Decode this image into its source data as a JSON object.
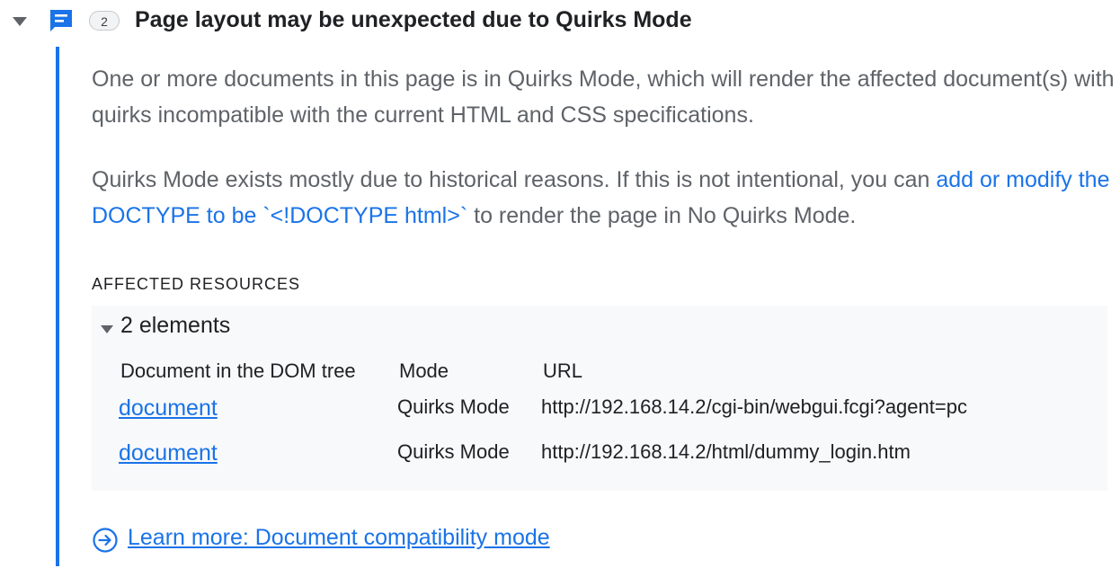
{
  "issue": {
    "count": "2",
    "title": "Page layout may be unexpected due to Quirks Mode",
    "paragraph1": "One or more documents in this page is in Quirks Mode, which will render the affected document(s) with quirks incompatible with the current HTML and CSS specifications.",
    "paragraph2_before": "Quirks Mode exists mostly due to historical reasons. If this is not intentional, you can ",
    "paragraph2_link": "add or modify the DOCTYPE to be `<!DOCTYPE html>`",
    "paragraph2_after": " to render the page in No Quirks Mode.",
    "icon": "issue-page-icon"
  },
  "affected": {
    "heading": "AFFECTED RESOURCES",
    "summary": "2 elements",
    "columns": [
      "Document in the DOM tree",
      "Mode",
      "URL"
    ],
    "rows": [
      {
        "document": "document",
        "mode": "Quirks Mode",
        "url": "http://192.168.14.2/cgi-bin/webgui.fcgi?agent=pc"
      },
      {
        "document": "document",
        "mode": "Quirks Mode",
        "url": "http://192.168.14.2/html/dummy_login.htm"
      }
    ]
  },
  "learn_more": {
    "label": "Learn more: Document compatibility mode",
    "icon": "arrow-circle-right-icon"
  },
  "colors": {
    "accent": "#1a73e8",
    "text": "#202124",
    "muted_text": "#5f6368",
    "panel_bg": "#f8f9fa"
  }
}
